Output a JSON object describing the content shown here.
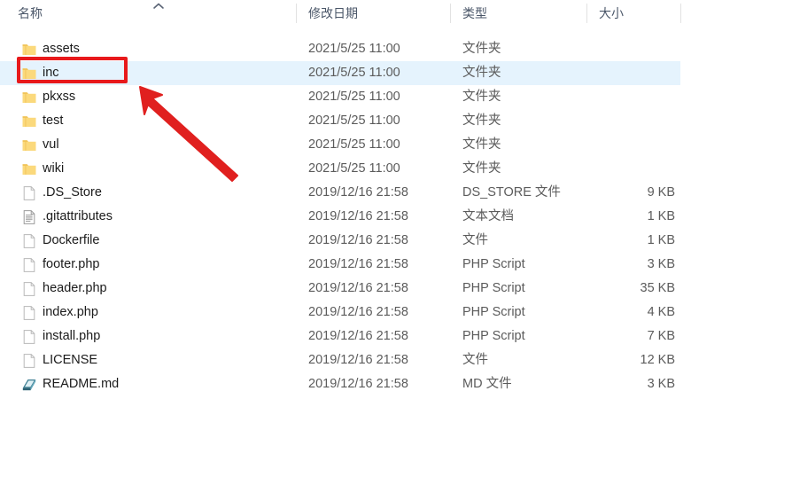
{
  "window": {
    "title": "File Explorer - file list view"
  },
  "columns": {
    "name": "名称",
    "date": "修改日期",
    "type": "类型",
    "size": "大小",
    "sort_indicator": "chevron-up-icon",
    "sorted_by": "名称",
    "sort_direction": "ascending"
  },
  "rows": [
    {
      "icon": "folder-icon",
      "name": "assets",
      "date": "2021/5/25 11:00",
      "type": "文件夹",
      "size": "",
      "selected": false
    },
    {
      "icon": "folder-icon",
      "name": "inc",
      "date": "2021/5/25 11:00",
      "type": "文件夹",
      "size": "",
      "selected": true
    },
    {
      "icon": "folder-icon",
      "name": "pkxss",
      "date": "2021/5/25 11:00",
      "type": "文件夹",
      "size": "",
      "selected": false
    },
    {
      "icon": "folder-icon",
      "name": "test",
      "date": "2021/5/25 11:00",
      "type": "文件夹",
      "size": "",
      "selected": false
    },
    {
      "icon": "folder-icon",
      "name": "vul",
      "date": "2021/5/25 11:00",
      "type": "文件夹",
      "size": "",
      "selected": false
    },
    {
      "icon": "folder-icon",
      "name": "wiki",
      "date": "2021/5/25 11:00",
      "type": "文件夹",
      "size": "",
      "selected": false
    },
    {
      "icon": "blank-file-icon",
      "name": ".DS_Store",
      "date": "2019/12/16 21:58",
      "type": "DS_STORE 文件",
      "size": "9 KB",
      "selected": false
    },
    {
      "icon": "text-document-icon",
      "name": ".gitattributes",
      "date": "2019/12/16 21:58",
      "type": "文本文档",
      "size": "1 KB",
      "selected": false
    },
    {
      "icon": "blank-file-icon",
      "name": "Dockerfile",
      "date": "2019/12/16 21:58",
      "type": "文件",
      "size": "1 KB",
      "selected": false
    },
    {
      "icon": "blank-file-icon",
      "name": "footer.php",
      "date": "2019/12/16 21:58",
      "type": "PHP Script",
      "size": "3 KB",
      "selected": false
    },
    {
      "icon": "blank-file-icon",
      "name": "header.php",
      "date": "2019/12/16 21:58",
      "type": "PHP Script",
      "size": "35 KB",
      "selected": false
    },
    {
      "icon": "blank-file-icon",
      "name": "index.php",
      "date": "2019/12/16 21:58",
      "type": "PHP Script",
      "size": "4 KB",
      "selected": false
    },
    {
      "icon": "blank-file-icon",
      "name": "install.php",
      "date": "2019/12/16 21:58",
      "type": "PHP Script",
      "size": "7 KB",
      "selected": false
    },
    {
      "icon": "blank-file-icon",
      "name": "LICENSE",
      "date": "2019/12/16 21:58",
      "type": "文件",
      "size": "12 KB",
      "selected": false
    },
    {
      "icon": "markdown-file-icon",
      "name": "README.md",
      "date": "2019/12/16 21:58",
      "type": "MD 文件",
      "size": "3 KB",
      "selected": false
    }
  ],
  "annotations": {
    "highlight_box": {
      "target": "inc",
      "color": "#e8191b",
      "shape": "rectangle-outline"
    },
    "arrow": {
      "target": "inc",
      "color": "#e8191b",
      "direction": "points-up-left"
    }
  },
  "colors": {
    "selection": "#e5f3fd",
    "annotation_red": "#e8191b",
    "folder_yellow": "#fbd36b",
    "header_text": "#4a5668",
    "secondary_text": "#5b5b5b"
  }
}
